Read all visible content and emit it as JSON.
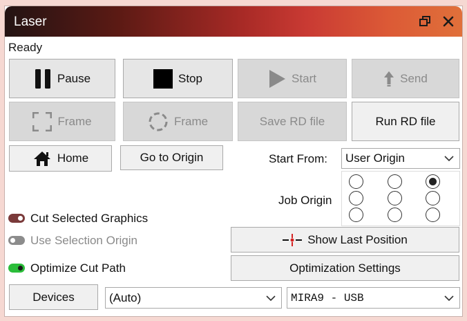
{
  "window": {
    "title": "Laser",
    "restore_icon": "restore-window-icon",
    "close_icon": "close-icon"
  },
  "status_text": "Ready",
  "buttons": {
    "pause": "Pause",
    "stop": "Stop",
    "start": "Start",
    "send": "Send",
    "frame_rect": "Frame",
    "frame_circle": "Frame",
    "save_rd": "Save RD file",
    "run_rd": "Run RD file",
    "home": "Home",
    "go_to_origin": "Go to Origin",
    "show_last_position": "Show Last Position",
    "optimization_settings": "Optimization Settings",
    "devices": "Devices"
  },
  "start_from": {
    "label": "Start From:",
    "value": "User Origin"
  },
  "job_origin": {
    "label": "Job Origin",
    "selected": "top-right",
    "grid": [
      [
        false,
        false,
        true
      ],
      [
        false,
        false,
        false
      ],
      [
        false,
        false,
        false
      ]
    ]
  },
  "options": {
    "cut_selected_graphics": {
      "label": "Cut Selected Graphics",
      "enabled": true,
      "on": true,
      "color": "#7a3a3a"
    },
    "use_selection_origin": {
      "label": "Use Selection Origin",
      "enabled": false,
      "on": false,
      "color": "#8c8c8c"
    },
    "optimize_cut_path": {
      "label": "Optimize Cut Path",
      "enabled": true,
      "on": true,
      "color": "#2bbd3a"
    }
  },
  "device_select": {
    "value": "(Auto)"
  },
  "port_select": {
    "value": "MIRA9 - USB"
  },
  "colors": {
    "title_gradient_start": "#231313",
    "title_gradient_mid": "#c93a33",
    "title_gradient_end": "#e0703a",
    "page_background": "#f6d8d2"
  }
}
